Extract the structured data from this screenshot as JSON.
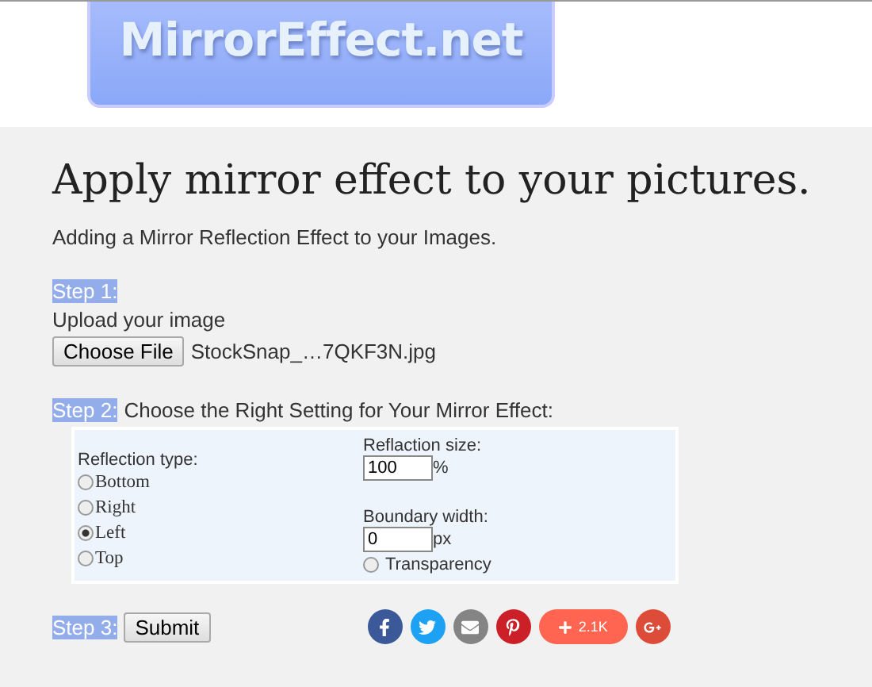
{
  "logo": {
    "text": "MirrorEffect.net"
  },
  "title": "Apply mirror effect to your pictures.",
  "subtitle": "Adding a Mirror Reflection Effect to your Images.",
  "step1": {
    "label": "Step 1:",
    "instruction": "Upload your image",
    "button": "Choose File",
    "file_name": "StockSnap_…7QKF3N.jpg"
  },
  "step2": {
    "label": "Step 2:",
    "instruction": "Choose the Right Setting for Your Mirror Effect:",
    "reflection_type": {
      "label": "Reflection type:",
      "options": [
        {
          "label": "Bottom",
          "selected": false
        },
        {
          "label": "Right",
          "selected": false
        },
        {
          "label": "Left",
          "selected": true
        },
        {
          "label": "Top",
          "selected": false
        }
      ]
    },
    "reflection_size": {
      "label": "Reflaction size:",
      "value": "100",
      "unit": "%"
    },
    "boundary_width": {
      "label": "Boundary width:",
      "value": "0",
      "unit": "px"
    },
    "transparency": {
      "label": "Transparency",
      "checked": false
    }
  },
  "step3": {
    "label": "Step 3:",
    "button": "Submit"
  },
  "share_buttons": [
    {
      "kind": "facebook",
      "color": "#3b5998"
    },
    {
      "kind": "twitter",
      "color": "#1da1f2"
    },
    {
      "kind": "email",
      "color": "#848484"
    },
    {
      "kind": "pinterest",
      "color": "#cb2027"
    },
    {
      "kind": "share",
      "color": "#ff6550",
      "count": "2.1K"
    },
    {
      "kind": "googleplus",
      "color": "#dd4b39"
    }
  ]
}
